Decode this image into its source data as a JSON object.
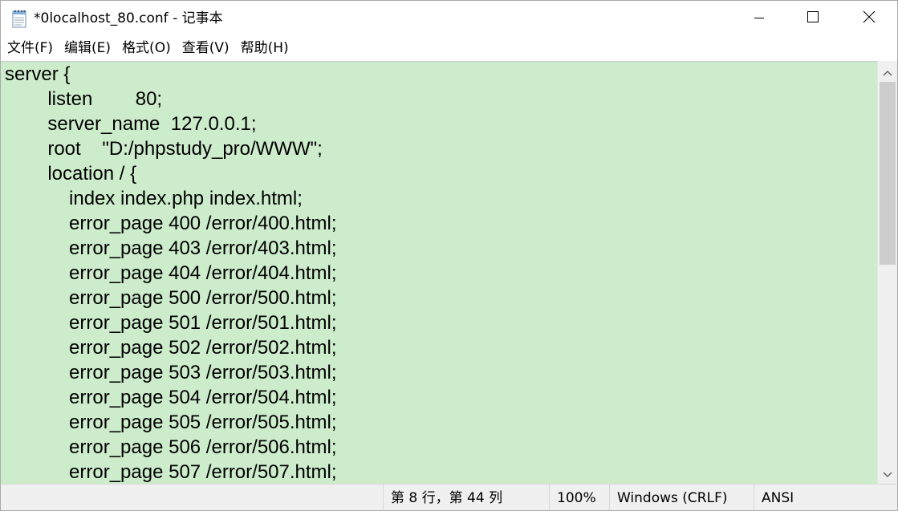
{
  "window": {
    "title": "*0localhost_80.conf - 记事本",
    "app_icon": "notepad-icon",
    "controls": {
      "minimize_icon": "minimize-icon",
      "maximize_icon": "maximize-icon",
      "close_icon": "close-icon"
    }
  },
  "menu": {
    "items": [
      {
        "label": "文件(F)"
      },
      {
        "label": "编辑(E)"
      },
      {
        "label": "格式(O)"
      },
      {
        "label": "查看(V)"
      },
      {
        "label": "帮助(H)"
      }
    ]
  },
  "editor": {
    "background": "#cdeccc",
    "lines": [
      "server {",
      "        listen        80;",
      "        server_name  127.0.0.1;",
      "        root    \"D:/phpstudy_pro/WWW\";",
      "        location / {",
      "            index index.php index.html;",
      "            error_page 400 /error/400.html;",
      "            error_page 403 /error/403.html;",
      "            error_page 404 /error/404.html;",
      "            error_page 500 /error/500.html;",
      "            error_page 501 /error/501.html;",
      "            error_page 502 /error/502.html;",
      "            error_page 503 /error/503.html;",
      "            error_page 504 /error/504.html;",
      "            error_page 505 /error/505.html;",
      "            error_page 506 /error/506.html;",
      "            error_page 507 /error/507.html;"
    ]
  },
  "scrollbar": {
    "up_icon": "scroll-up-arrow-icon",
    "down_icon": "scroll-down-arrow-icon"
  },
  "status": {
    "position": "第 8 行，第 44 列",
    "zoom": "100%",
    "line_ending": "Windows (CRLF)",
    "encoding": "ANSI"
  }
}
